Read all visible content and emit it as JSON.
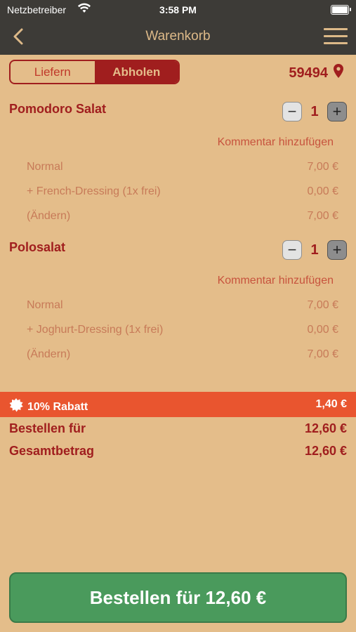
{
  "status": {
    "carrier": "Netzbetreiber",
    "time": "3:58 PM"
  },
  "nav": {
    "title": "Warenkorb"
  },
  "mode": {
    "delivery_label": "Liefern",
    "pickup_label": "Abholen",
    "selected": "Abholen"
  },
  "location": {
    "zip": "59494"
  },
  "cart": [
    {
      "name": "Pomodoro Salat",
      "qty": "1",
      "comment_label": "Kommentar hinzufügen",
      "lines": [
        {
          "label": "Normal",
          "price": "7,00 €"
        },
        {
          "label": "+ French-Dressing (1x frei)",
          "price": "0,00 €"
        },
        {
          "label": "(Ändern)",
          "price": "7,00 €"
        }
      ]
    },
    {
      "name": "Polosalat",
      "qty": "1",
      "comment_label": "Kommentar hinzufügen",
      "lines": [
        {
          "label": "Normal",
          "price": "7,00 €"
        },
        {
          "label": "+ Joghurt-Dressing (1x frei)",
          "price": "0,00 €"
        },
        {
          "label": "(Ändern)",
          "price": "7,00 €"
        }
      ]
    }
  ],
  "discount": {
    "label": "10% Rabatt",
    "value": "1,40 €"
  },
  "totals": {
    "order_for_label": "Bestellen für",
    "order_for_value": "12,60 €",
    "grand_total_label": "Gesamtbetrag",
    "grand_total_value": "12,60 €"
  },
  "checkout": {
    "button_label": "Bestellen für 12,60 €"
  },
  "colors": {
    "background": "#e4bd8a",
    "accent": "#a01e1e",
    "bar": "#3d3b37",
    "discount": "#e9552f",
    "checkout": "#4a9a5c"
  }
}
